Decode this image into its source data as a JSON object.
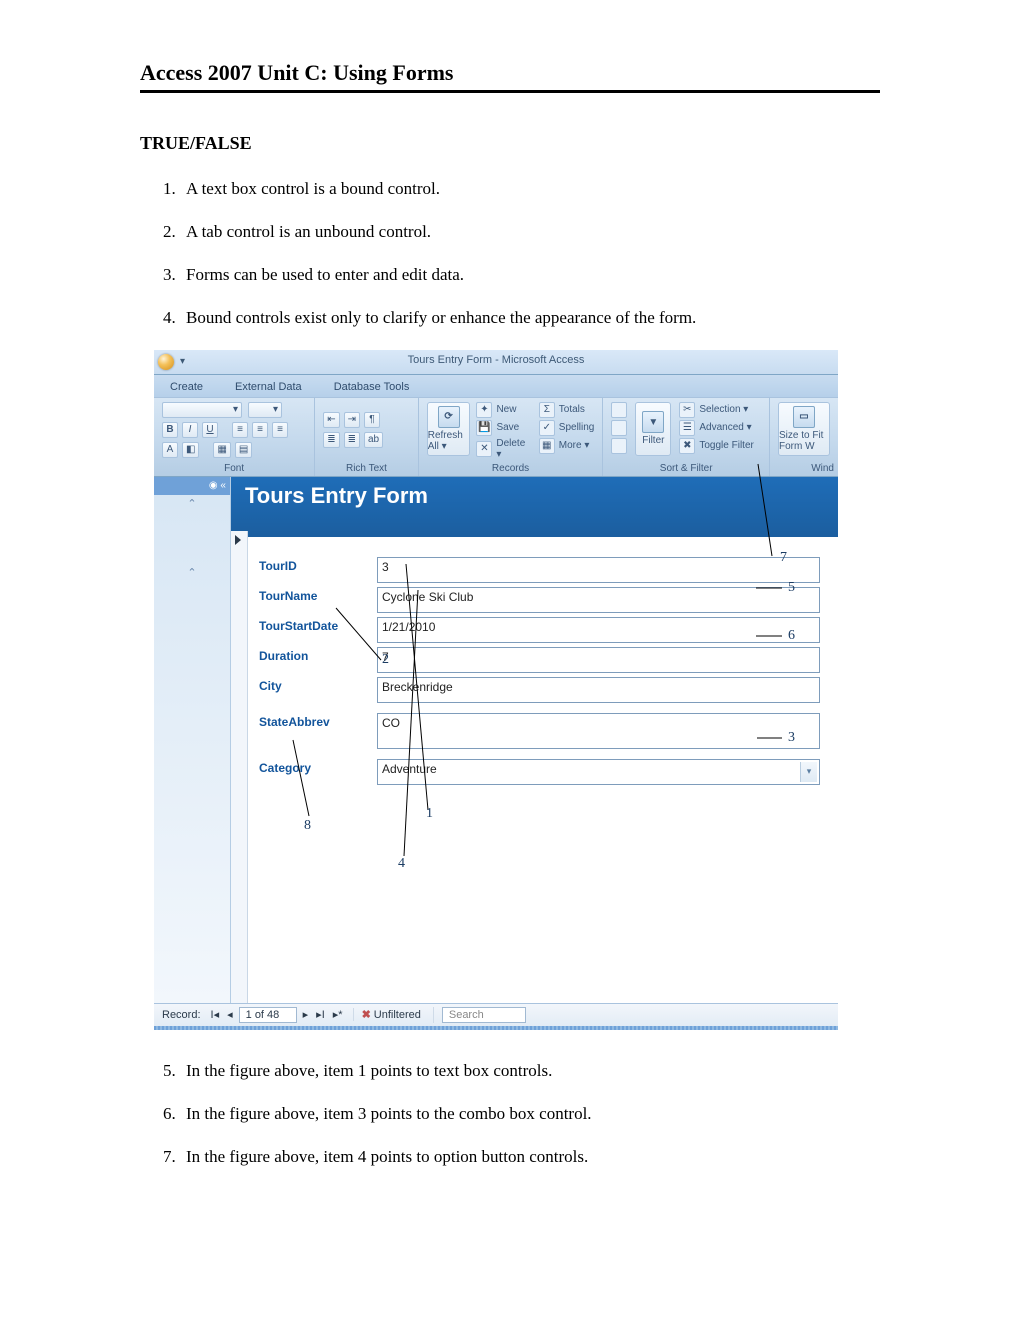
{
  "doc": {
    "title": "Access 2007 Unit C: Using Forms",
    "section_label": "TRUE/FALSE",
    "q1_4": [
      "A text box control is a bound control.",
      "A tab control is an unbound control.",
      "Forms can be used to enter and edit data.",
      "Bound controls exist only to clarify or enhance the appearance of the form."
    ],
    "q5_7": [
      "In the figure above, item 1 points to text box controls.",
      "In the figure above, item 3 points to the combo box control.",
      "In the figure above, item 4 points to option button controls."
    ]
  },
  "ss": {
    "window_title": "Tours Entry Form - Microsoft Access",
    "tabs": {
      "create": "Create",
      "external": "External Data",
      "dbtools": "Database Tools"
    },
    "ribbon": {
      "font_label": "Font",
      "richtext_label": "Rich Text",
      "records": {
        "refresh": "Refresh All ▾",
        "new": "New",
        "save": "Save",
        "delete": "Delete ▾",
        "totals": "Totals",
        "spelling": "Spelling",
        "more": "More ▾",
        "label": "Records"
      },
      "sortfilter": {
        "filter": "Filter",
        "selection": "Selection ▾",
        "advanced": "Advanced ▾",
        "toggle": "Toggle Filter",
        "label": "Sort & Filter"
      },
      "window": {
        "sizeto": "Size to Fit Form W",
        "label": "Wind"
      }
    },
    "form": {
      "title": "Tours Entry Form",
      "fields": {
        "tourid_label": "TourID",
        "tourid_value": "3",
        "tourname_label": "TourName",
        "tourname_value": "Cyclone Ski Club",
        "start_label": "TourStartDate",
        "start_value": "1/21/2010",
        "duration_label": "Duration",
        "duration_value": "7",
        "city_label": "City",
        "city_value": "Breckenridge",
        "state_label": "StateAbbrev",
        "state_value": "CO",
        "category_label": "Category",
        "category_value": "Adventure"
      }
    },
    "recnav": {
      "label": "Record:",
      "pos": "1 of 48",
      "unfiltered": "Unfiltered",
      "search": "Search"
    },
    "callouts": {
      "c1": "1",
      "c2": "2",
      "c3": "3",
      "c4": "4",
      "c5": "5",
      "c6": "6",
      "c7": "7",
      "c8": "8"
    }
  }
}
